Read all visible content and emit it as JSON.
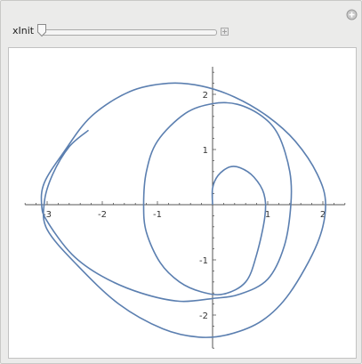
{
  "control": {
    "label": "xInit",
    "value": 0
  },
  "icons": {
    "panel_plus": "plus-circle-icon",
    "slider_expand": "plus-square-icon"
  },
  "chart_data": {
    "type": "line",
    "title": "",
    "xlabel": "",
    "ylabel": "",
    "xlim": [
      -3.4,
      2.4
    ],
    "ylim": [
      -2.6,
      2.5
    ],
    "grid": false,
    "legend": "none",
    "color": "#5b7fb0",
    "x_ticks": [
      {
        "value": -3,
        "label": "-3"
      },
      {
        "value": -2,
        "label": "-2"
      },
      {
        "value": -1,
        "label": "-1"
      },
      {
        "value": 1,
        "label": "1"
      },
      {
        "value": 2,
        "label": "2"
      }
    ],
    "y_ticks": [
      {
        "value": -2,
        "label": "-2"
      },
      {
        "value": -1,
        "label": "-1"
      },
      {
        "value": 1,
        "label": "1"
      },
      {
        "value": 2,
        "label": "2"
      }
    ],
    "series": [
      {
        "points": [
          [
            0.0,
            0.0
          ],
          [
            0.0,
            0.3
          ],
          [
            0.1,
            0.53
          ],
          [
            0.3,
            0.68
          ],
          [
            0.5,
            0.67
          ],
          [
            0.75,
            0.5
          ],
          [
            0.93,
            0.2
          ],
          [
            0.95,
            -0.2
          ],
          [
            0.8,
            -0.9
          ],
          [
            0.6,
            -1.4
          ],
          [
            0.2,
            -1.62
          ],
          [
            -0.2,
            -1.58
          ],
          [
            -0.6,
            -1.4
          ],
          [
            -0.95,
            -1.05
          ],
          [
            -1.2,
            -0.5
          ],
          [
            -1.25,
            0.0
          ],
          [
            -1.2,
            0.6
          ],
          [
            -1.0,
            1.15
          ],
          [
            -0.5,
            1.65
          ],
          [
            0.0,
            1.83
          ],
          [
            0.45,
            1.82
          ],
          [
            0.9,
            1.6
          ],
          [
            1.2,
            1.25
          ],
          [
            1.4,
            0.6
          ],
          [
            1.42,
            0.0
          ],
          [
            1.3,
            -0.75
          ],
          [
            1.0,
            -1.35
          ],
          [
            0.5,
            -1.62
          ],
          [
            0.0,
            -1.7
          ],
          [
            -0.6,
            -1.75
          ],
          [
            -1.3,
            -1.6
          ],
          [
            -2.0,
            -1.3
          ],
          [
            -2.55,
            -0.9
          ],
          [
            -3.0,
            -0.3
          ],
          [
            -3.1,
            0.0
          ],
          [
            -3.05,
            0.4
          ],
          [
            -2.7,
            0.95
          ],
          [
            -2.2,
            1.6
          ],
          [
            -1.5,
            2.05
          ],
          [
            -0.8,
            2.2
          ],
          [
            -0.2,
            2.15
          ],
          [
            0.4,
            1.95
          ],
          [
            1.0,
            1.6
          ],
          [
            1.5,
            1.15
          ],
          [
            1.9,
            0.55
          ],
          [
            2.05,
            0.0
          ],
          [
            1.9,
            -0.7
          ],
          [
            1.4,
            -1.6
          ],
          [
            0.9,
            -2.1
          ],
          [
            0.3,
            -2.35
          ],
          [
            -0.25,
            -2.4
          ],
          [
            -0.9,
            -2.25
          ],
          [
            -1.7,
            -1.8
          ],
          [
            -2.45,
            -1.1
          ],
          [
            -3.0,
            -0.45
          ],
          [
            -3.05,
            0.05
          ],
          [
            -2.9,
            0.55
          ],
          [
            -2.6,
            1.05
          ],
          [
            -2.25,
            1.35
          ]
        ]
      }
    ]
  }
}
